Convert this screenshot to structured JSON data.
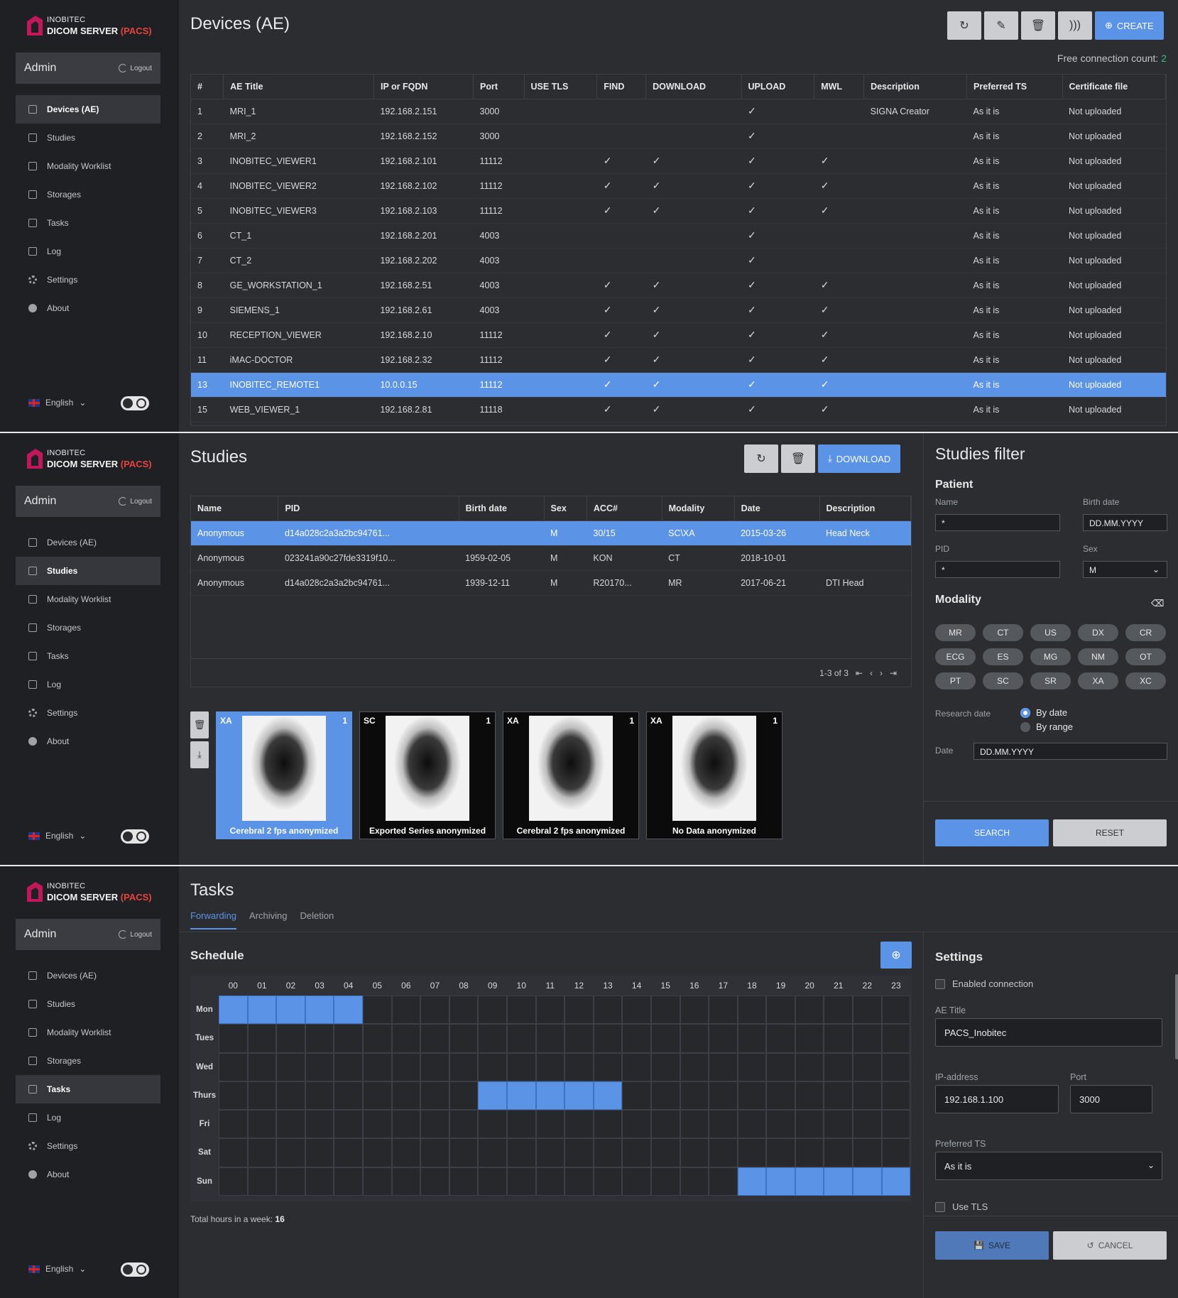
{
  "brand": {
    "small": "INOBITEC",
    "big": "DICOM SERVER",
    "pacs": "(PACS)"
  },
  "user": {
    "name": "Admin",
    "logout": "Logout"
  },
  "nav": [
    "Devices (AE)",
    "Studies",
    "Modality Worklist",
    "Storages",
    "Tasks",
    "Log",
    "Settings",
    "About"
  ],
  "language": "English",
  "devices": {
    "title": "Devices (AE)",
    "create_label": "CREATE",
    "free_label": "Free connection count:",
    "free_count": "2",
    "columns": [
      "#",
      "AE Title",
      "IP or FQDN",
      "Port",
      "USE TLS",
      "FIND",
      "DOWNLOAD",
      "UPLOAD",
      "MWL",
      "Description",
      "Preferred TS",
      "Certificate file"
    ],
    "rows": [
      {
        "n": "1",
        "ae": "MRI_1",
        "ip": "192.168.2.151",
        "port": "3000",
        "tls": false,
        "find": false,
        "dl": false,
        "up": true,
        "mwl": false,
        "desc": "SIGNA Creator",
        "ts": "As it is",
        "cert": "Not uploaded"
      },
      {
        "n": "2",
        "ae": "MRI_2",
        "ip": "192.168.2.152",
        "port": "3000",
        "tls": false,
        "find": false,
        "dl": false,
        "up": true,
        "mwl": false,
        "desc": "",
        "ts": "As it is",
        "cert": "Not uploaded"
      },
      {
        "n": "3",
        "ae": "INOBITEC_VIEWER1",
        "ip": "192.168.2.101",
        "port": "11112",
        "tls": false,
        "find": true,
        "dl": true,
        "up": true,
        "mwl": true,
        "desc": "",
        "ts": "As it is",
        "cert": "Not uploaded"
      },
      {
        "n": "4",
        "ae": "INOBITEC_VIEWER2",
        "ip": "192.168.2.102",
        "port": "11112",
        "tls": false,
        "find": true,
        "dl": true,
        "up": true,
        "mwl": true,
        "desc": "",
        "ts": "As it is",
        "cert": "Not uploaded"
      },
      {
        "n": "5",
        "ae": "INOBITEC_VIEWER3",
        "ip": "192.168.2.103",
        "port": "11112",
        "tls": false,
        "find": true,
        "dl": true,
        "up": true,
        "mwl": true,
        "desc": "",
        "ts": "As it is",
        "cert": "Not uploaded"
      },
      {
        "n": "6",
        "ae": "CT_1",
        "ip": "192.168.2.201",
        "port": "4003",
        "tls": false,
        "find": false,
        "dl": false,
        "up": true,
        "mwl": false,
        "desc": "",
        "ts": "As it is",
        "cert": "Not uploaded"
      },
      {
        "n": "7",
        "ae": "CT_2",
        "ip": "192.168.2.202",
        "port": "4003",
        "tls": false,
        "find": false,
        "dl": false,
        "up": true,
        "mwl": false,
        "desc": "",
        "ts": "As it is",
        "cert": "Not uploaded"
      },
      {
        "n": "8",
        "ae": "GE_WORKSTATION_1",
        "ip": "192.168.2.51",
        "port": "4003",
        "tls": false,
        "find": true,
        "dl": true,
        "up": true,
        "mwl": true,
        "desc": "",
        "ts": "As it is",
        "cert": "Not uploaded"
      },
      {
        "n": "9",
        "ae": "SIEMENS_1",
        "ip": "192.168.2.61",
        "port": "4003",
        "tls": false,
        "find": true,
        "dl": true,
        "up": true,
        "mwl": true,
        "desc": "",
        "ts": "As it is",
        "cert": "Not uploaded"
      },
      {
        "n": "10",
        "ae": "RECEPTION_VIEWER",
        "ip": "192.168.2.10",
        "port": "11112",
        "tls": false,
        "find": true,
        "dl": true,
        "up": true,
        "mwl": true,
        "desc": "",
        "ts": "As it is",
        "cert": "Not uploaded"
      },
      {
        "n": "11",
        "ae": "iMAC-DOCTOR",
        "ip": "192.168.2.32",
        "port": "11112",
        "tls": false,
        "find": true,
        "dl": true,
        "up": true,
        "mwl": true,
        "desc": "",
        "ts": "As it is",
        "cert": "Not uploaded"
      },
      {
        "n": "13",
        "ae": "INOBITEC_REMOTE1",
        "ip": "10.0.0.15",
        "port": "11112",
        "tls": false,
        "find": true,
        "dl": true,
        "up": true,
        "mwl": true,
        "desc": "",
        "ts": "As it is",
        "cert": "Not uploaded",
        "selected": true
      },
      {
        "n": "15",
        "ae": "WEB_VIEWER_1",
        "ip": "192.168.2.81",
        "port": "11118",
        "tls": false,
        "find": true,
        "dl": true,
        "up": true,
        "mwl": true,
        "desc": "",
        "ts": "As it is",
        "cert": "Not uploaded"
      }
    ]
  },
  "studies": {
    "title": "Studies",
    "download_label": "DOWNLOAD",
    "columns": [
      "Name",
      "PID",
      "Birth date",
      "Sex",
      "ACC#",
      "Modality",
      "Date",
      "Description"
    ],
    "rows": [
      {
        "name": "Anonymous",
        "pid": "d14a028c2a3a2bc94761...",
        "birth": "",
        "sex": "M",
        "acc": "30/15",
        "mod": "SC\\XA",
        "date": "2015-03-26",
        "desc": "Head Neck",
        "selected": true
      },
      {
        "name": "Anonymous",
        "pid": "023241a90c27fde3319f10...",
        "birth": "1959-02-05",
        "sex": "M",
        "acc": "KON",
        "mod": "CT",
        "date": "2018-10-01",
        "desc": ""
      },
      {
        "name": "Anonymous",
        "pid": "d14a028c2a3a2bc94761...",
        "birth": "1939-12-11",
        "sex": "M",
        "acc": "R20170...",
        "mod": "MR",
        "date": "2017-06-21",
        "desc": "DTI Head"
      }
    ],
    "pager": "1-3 of 3",
    "series": [
      {
        "mod": "XA",
        "count": "1",
        "caption": "Cerebral 2 fps anonymized",
        "selected": true
      },
      {
        "mod": "SC",
        "count": "1",
        "caption": "Exported Series anonymized"
      },
      {
        "mod": "XA",
        "count": "1",
        "caption": "Cerebral 2 fps anonymized"
      },
      {
        "mod": "XA",
        "count": "1",
        "caption": "No Data anonymized"
      }
    ]
  },
  "filter": {
    "title": "Studies filter",
    "patient": "Patient",
    "name_label": "Name",
    "name_value": "*",
    "birth_label": "Birth date",
    "birth_value": "DD.MM.YYYY",
    "pid_label": "PID",
    "pid_value": "*",
    "sex_label": "Sex",
    "sex_value": "M",
    "modality": "Modality",
    "chips": [
      "MR",
      "CT",
      "US",
      "DX",
      "CR",
      "ECG",
      "ES",
      "MG",
      "NM",
      "OT",
      "PT",
      "SC",
      "SR",
      "XA",
      "XC"
    ],
    "research_date": "Research date",
    "by_date": "By date",
    "by_range": "By range",
    "date_label": "Date",
    "date_value": "DD.MM.YYYY",
    "search": "SEARCH",
    "reset": "RESET"
  },
  "tasks": {
    "title": "Tasks",
    "tabs": [
      "Forwarding",
      "Archiving",
      "Deletion"
    ],
    "schedule": "Schedule",
    "hours": [
      "00",
      "01",
      "02",
      "03",
      "04",
      "05",
      "06",
      "07",
      "08",
      "09",
      "10",
      "11",
      "12",
      "13",
      "14",
      "15",
      "16",
      "17",
      "18",
      "19",
      "20",
      "21",
      "22",
      "23"
    ],
    "days": [
      "Mon",
      "Tues",
      "Wed",
      "Thurs",
      "Fri",
      "Sat",
      "Sun"
    ],
    "active": {
      "Mon": [
        0,
        1,
        2,
        3,
        4
      ],
      "Thurs": [
        9,
        10,
        11,
        12,
        13
      ],
      "Sun": [
        18,
        19,
        20,
        21,
        22,
        23
      ]
    },
    "total_label": "Total hours in a week:",
    "total_value": "16"
  },
  "settings": {
    "title": "Settings",
    "enabled": "Enabled connection",
    "ae_label": "AE Title",
    "ae_value": "PACS_Inobitec",
    "ip_label": "IP-address",
    "ip_value": "192.168.1.100",
    "port_label": "Port",
    "port_value": "3000",
    "ts_label": "Preferred TS",
    "ts_value": "As it is",
    "tls": "Use TLS",
    "save": "SAVE",
    "cancel": "CANCEL"
  },
  "colors": {
    "accent": "#5b93e6",
    "sidebar": "#1f2023",
    "bg": "#2b2d31",
    "pacs": "#e8433e",
    "free": "#3dbf7a"
  }
}
